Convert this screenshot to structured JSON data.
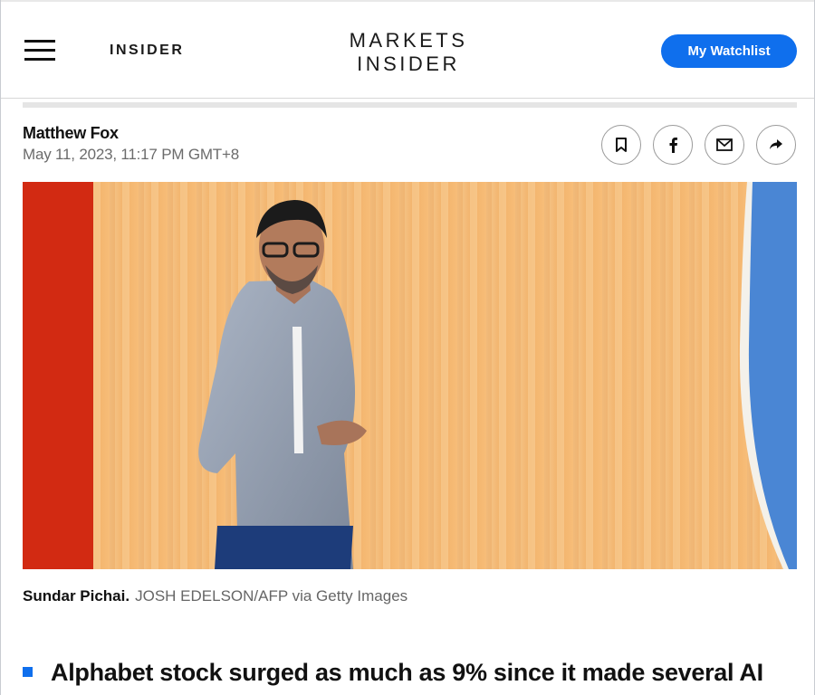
{
  "header": {
    "insider_logo": "INSIDER",
    "markets_line1": "MARKETS",
    "markets_line2": "INSIDER",
    "watchlist_label": "My Watchlist",
    "accent_color": "#0f6fed"
  },
  "article": {
    "author": "Matthew Fox",
    "date": "May 11, 2023, 11:17 PM GMT+8",
    "share_icons": [
      "bookmark-icon",
      "facebook-icon",
      "email-icon",
      "share-arrow-icon"
    ],
    "image_caption_name": "Sundar Pichai.",
    "image_caption_credit": "JOSH EDELSON/AFP via Getty Images",
    "bullet_1": "Alphabet stock surged as much as 9% since it made several AI"
  }
}
